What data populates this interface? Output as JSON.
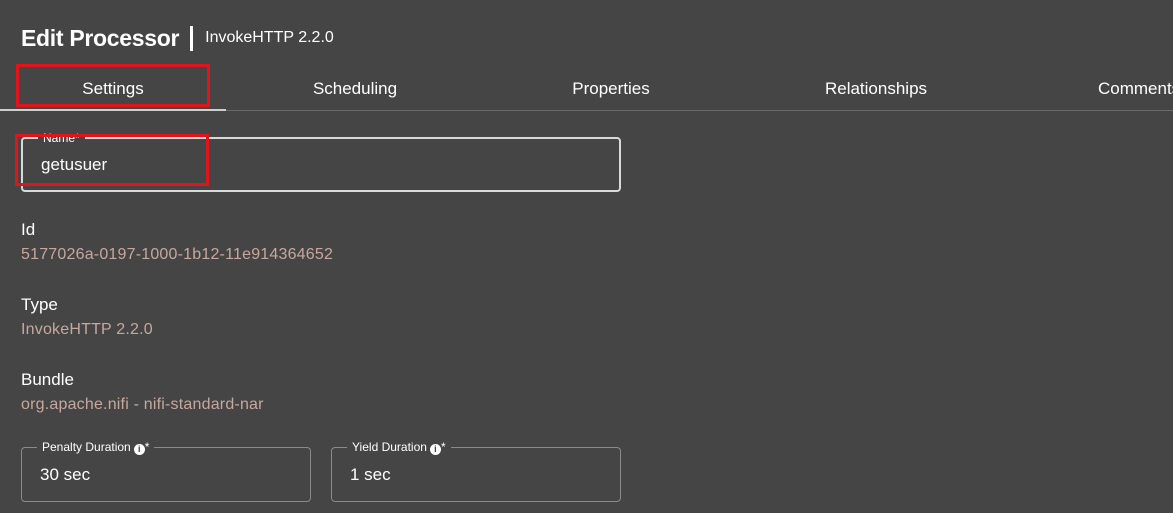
{
  "header": {
    "title": "Edit Processor",
    "subtitle": "InvokeHTTP 2.2.0"
  },
  "tabs": [
    {
      "label": "Settings",
      "active": true
    },
    {
      "label": "Scheduling",
      "active": false
    },
    {
      "label": "Properties",
      "active": false
    },
    {
      "label": "Relationships",
      "active": false
    },
    {
      "label": "Comments",
      "active": false
    }
  ],
  "name_field": {
    "label": "Name",
    "required_marker": "*",
    "value": "getusuer"
  },
  "details": {
    "id": {
      "label": "Id",
      "value": "5177026a-0197-1000-1b12-11e914364652"
    },
    "type": {
      "label": "Type",
      "value": "InvokeHTTP 2.2.0"
    },
    "bundle": {
      "label": "Bundle",
      "value": "org.apache.nifi - nifi-standard-nar"
    }
  },
  "penalty_duration": {
    "label": "Penalty Duration",
    "required_marker": "*",
    "value": "30 sec"
  },
  "yield_duration": {
    "label": "Yield Duration",
    "required_marker": "*",
    "value": "1 sec"
  },
  "colors": {
    "background": "#454545",
    "value_text": "#c7a89f",
    "highlight": "#e0141b"
  },
  "icons": {
    "info": "info-icon"
  }
}
